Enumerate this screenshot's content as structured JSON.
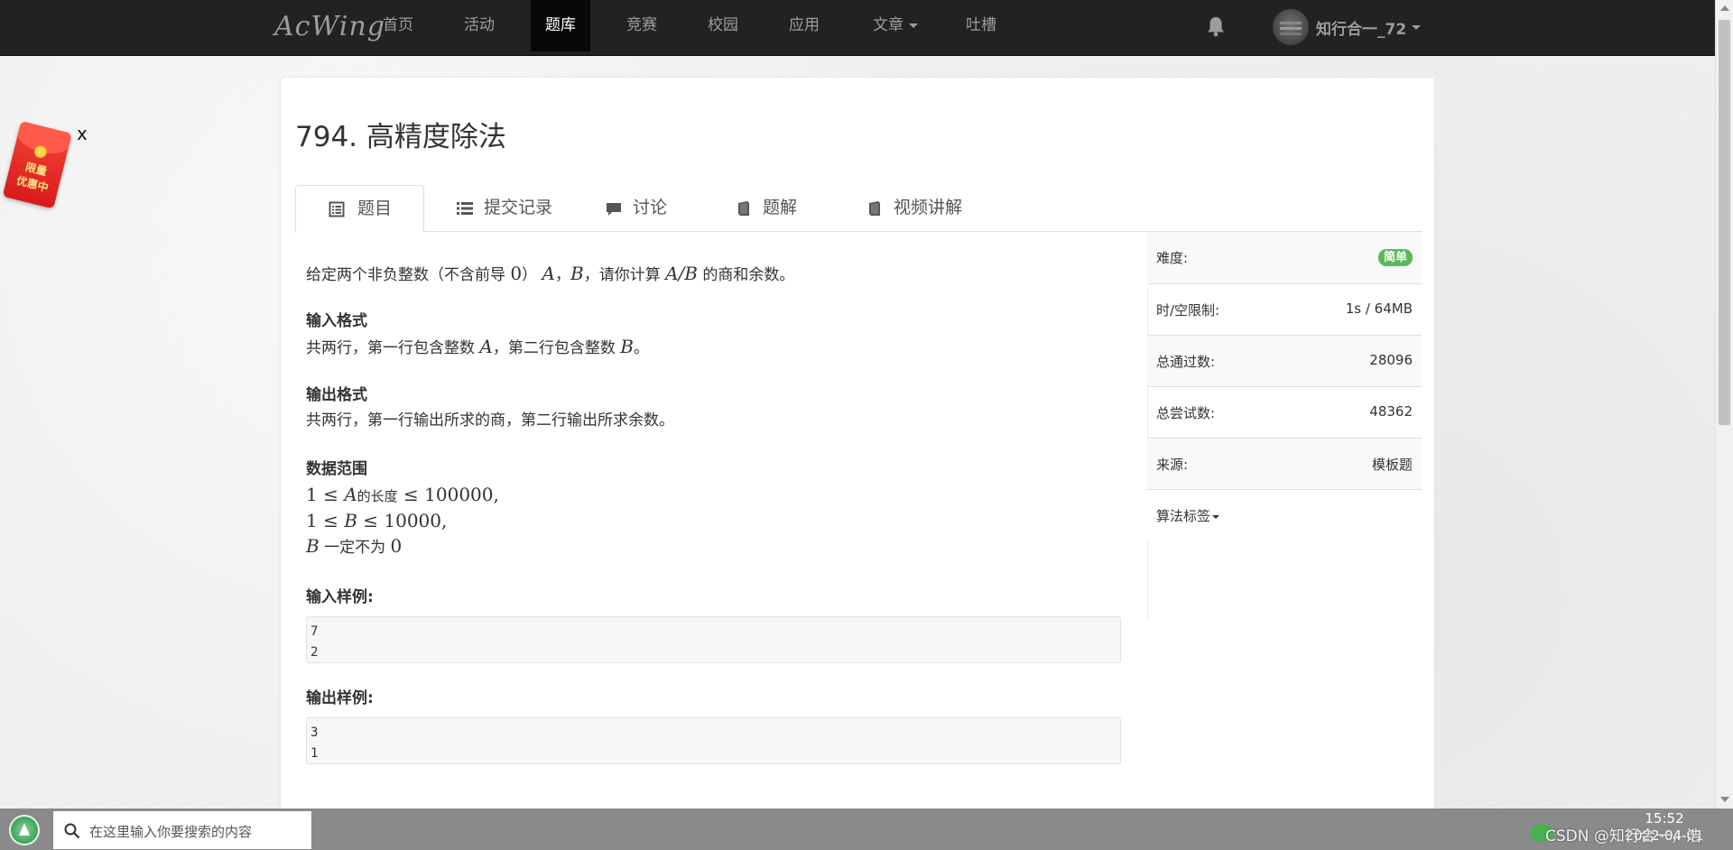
{
  "navbar": {
    "brand": "AcWing",
    "items": [
      {
        "label": "首页"
      },
      {
        "label": "活动"
      },
      {
        "label": "题库",
        "active": true
      },
      {
        "label": "竞赛"
      },
      {
        "label": "校园"
      },
      {
        "label": "应用"
      },
      {
        "label": "文章",
        "dropdown": true
      },
      {
        "label": "吐槽"
      }
    ],
    "notification_icon": "bell-icon",
    "user": {
      "name": "知行合一_72",
      "dropdown": true
    }
  },
  "ad": {
    "text_line1": "限量",
    "text_line2": "优惠中",
    "close_label": "x"
  },
  "problem": {
    "title": "794. 高精度除法",
    "tabs": [
      {
        "label": "题目",
        "icon": "list-alt-icon",
        "active": true
      },
      {
        "label": "提交记录",
        "icon": "list-icon"
      },
      {
        "label": "讨论",
        "icon": "comment-icon"
      },
      {
        "label": "题解",
        "icon": "book-icon"
      },
      {
        "label": "视频讲解",
        "icon": "book-icon"
      }
    ],
    "description": {
      "t1": "给定两个非负整数（不含前导 ",
      "zero": "0",
      "t2": "）",
      "A": "A",
      "comma1": "，",
      "B": "B",
      "t3": "，请你计算 ",
      "AdivB": "A/B",
      "t4": " 的商和余数。"
    },
    "input_format": {
      "heading": "输入格式",
      "t1": "共两行，第一行包含整数 ",
      "A": "A",
      "t2": "，第二行包含整数 ",
      "B": "B",
      "t3": "。"
    },
    "output_format": {
      "heading": "输出格式",
      "text": "共两行，第一行输出所求的商，第二行输出所求余数。"
    },
    "data_range": {
      "heading": "数据范围",
      "line1": {
        "pre": "1 ≤ ",
        "var": "A",
        "mid": "的长度",
        "post": " ≤ 100000,"
      },
      "line2": {
        "pre": "1 ≤ ",
        "var": "B",
        "post": " ≤ 10000,"
      },
      "line3": {
        "var": "B",
        "mid": " 一定不为 ",
        "post": "0"
      }
    },
    "sample_input": {
      "heading": "输入样例:",
      "line1": "7",
      "line2": "2"
    },
    "sample_output": {
      "heading": "输出样例:",
      "line1": "3",
      "line2": "1"
    }
  },
  "sidebar": {
    "difficulty": {
      "label": "难度:",
      "value": "简单",
      "color": "#5cb85c"
    },
    "limits": {
      "label": "时/空限制:",
      "value": "1s / 64MB"
    },
    "passed": {
      "label": "总通过数:",
      "value": "28096"
    },
    "attempts": {
      "label": "总尝试数:",
      "value": "48362"
    },
    "source": {
      "label": "来源:",
      "value": "模板题"
    },
    "tags": {
      "label": "算法标签"
    }
  },
  "taskbar": {
    "search_placeholder": "在这里输入你要搜索的内容",
    "time": "15:52",
    "date": "2022-04-01",
    "watermark": "CSDN @知行合一，浩"
  }
}
